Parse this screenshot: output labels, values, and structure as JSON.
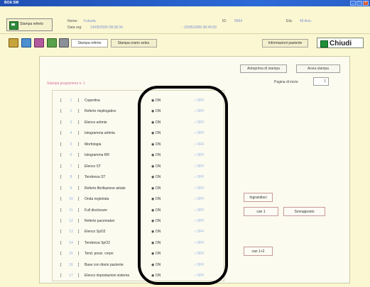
{
  "window": {
    "title": "BOA SW"
  },
  "header": {
    "stampa_btn": "Stampa referto",
    "nome_label": "Nome:",
    "nome_value": "Fukuda",
    "data_label": "Data reg:",
    "data_value": "14/05/2005 08:38:34",
    "range_value": "- 15/05/2005 08:40:00",
    "id_label": "ID:",
    "id_value": "5664",
    "eta_label": "Età:",
    "eta_value": "45 Ann."
  },
  "toolbar": {
    "tabs": [
      "Stampa referto",
      "Stampa orario selez."
    ],
    "info": "Informazioni paziente",
    "chiudi": "Chiudi"
  },
  "panel": {
    "anteprima": "Anteprima di stampa",
    "avvia": "Avvia stampa",
    "pagina_label": "Pagina di inizio",
    "pagina_value": "1",
    "program_title": "Stampa programma n. 1"
  },
  "rows": [
    {
      "n": "1",
      "name": "Copertina",
      "on": "ON",
      "off": "OFF"
    },
    {
      "n": "2",
      "name": "Referto riepilogativo",
      "on": "ON",
      "off": "OFF"
    },
    {
      "n": "3",
      "name": "Elenco aritmie",
      "on": "ON",
      "off": "OFF"
    },
    {
      "n": "4",
      "name": "Istogramma aritmia",
      "on": "ON",
      "off": "OFF"
    },
    {
      "n": "5",
      "name": "Morfologia",
      "on": "ON",
      "off": "OFF"
    },
    {
      "n": "6",
      "name": "Istogramma RR",
      "on": "ON",
      "off": "OFF"
    },
    {
      "n": "7",
      "name": "Elenco ST",
      "on": "ON",
      "off": "OFF"
    },
    {
      "n": "8",
      "name": "Tendenza ST",
      "on": "ON",
      "off": "OFF"
    },
    {
      "n": "9",
      "name": "Referto fibrillazione atriale",
      "on": "ON",
      "off": "OFF"
    },
    {
      "n": "10",
      "name": "Onda registrata",
      "on": "ON",
      "off": "OFF"
    },
    {
      "n": "11",
      "name": "Full disclosure",
      "on": "ON",
      "off": "OFF"
    },
    {
      "n": "12",
      "name": "Referto pacemaker",
      "on": "ON",
      "off": "OFF"
    },
    {
      "n": "13",
      "name": "Elenco SpO2",
      "on": "ON",
      "off": "OFF"
    },
    {
      "n": "14",
      "name": "Tendenza SpO2",
      "on": "ON",
      "off": "OFF"
    },
    {
      "n": "15",
      "name": "Tend. posiz. corpo",
      "on": "ON",
      "off": "OFF"
    },
    {
      "n": "16",
      "name": "Base con diario paziente",
      "on": "ON",
      "off": "OFF"
    },
    {
      "n": "17",
      "name": "Elenco impostazioni sistema",
      "on": "ON",
      "off": "OFF"
    }
  ],
  "side_buttons": {
    "ingrandisci": "Ingrandisci",
    "can1": "can 1",
    "sovrapposto": "Sovrapposto",
    "can12": "can 1+2"
  }
}
